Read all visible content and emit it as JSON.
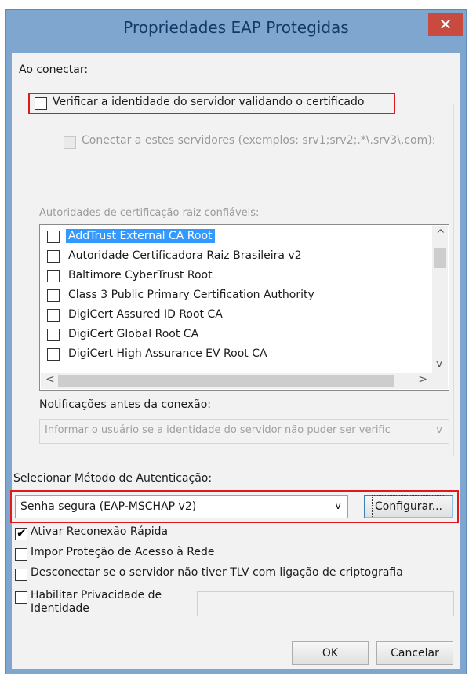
{
  "dialog": {
    "title": "Propriedades EAP Protegidas",
    "close_glyph": "✕"
  },
  "connect": {
    "section_label": "Ao conectar:",
    "verify_cert_label": "Verificar a identidade do servidor validando o certificado",
    "verify_cert_checked": false,
    "connect_servers_label": "Conectar a estes servidores (exemplos: srv1;srv2;.*\\.srv3\\.com):",
    "servers_value": "",
    "ca_label": "Autoridades de certificação raiz confiáveis:",
    "ca_list": [
      {
        "name": "AddTrust External CA Root",
        "checked": false,
        "selected": true
      },
      {
        "name": "Autoridade Certificadora Raiz Brasileira v2",
        "checked": false,
        "selected": false
      },
      {
        "name": "Baltimore CyberTrust Root",
        "checked": false,
        "selected": false
      },
      {
        "name": "Class 3 Public Primary Certification Authority",
        "checked": false,
        "selected": false
      },
      {
        "name": "DigiCert Assured ID Root CA",
        "checked": false,
        "selected": false
      },
      {
        "name": "DigiCert Global Root CA",
        "checked": false,
        "selected": false
      },
      {
        "name": "DigiCert High Assurance EV Root CA",
        "checked": false,
        "selected": false
      }
    ],
    "notifications_label": "Notificações antes da conexão:",
    "notifications_value": "Informar o usuário se a identidade do servidor não puder ser verific"
  },
  "auth": {
    "method_label": "Selecionar Método de Autenticação:",
    "method_value": "Senha segura (EAP-MSCHAP v2)",
    "configure_label": "Configurar...",
    "options": [
      {
        "label": "Ativar Reconexão Rápida",
        "checked": true
      },
      {
        "label": "Impor Proteção de Acesso à Rede",
        "checked": false
      },
      {
        "label": "Desconectar se o servidor não tiver TLV com ligação de criptografia",
        "checked": false
      }
    ],
    "privacy_label_line1": "Habilitar Privacidade de",
    "privacy_label_line2": "Identidade",
    "privacy_checked": false,
    "privacy_value": ""
  },
  "footer": {
    "ok_label": "OK",
    "cancel_label": "Cancelar"
  },
  "icons": {
    "scroll_up": "^",
    "scroll_down": "v",
    "scroll_left": "<",
    "scroll_right": ">",
    "combo_chevron": "v"
  },
  "colors": {
    "highlight": "#e0191f",
    "selection": "#3399ff",
    "window_frame": "#7fa6cf",
    "close_button": "#c94a3f"
  }
}
